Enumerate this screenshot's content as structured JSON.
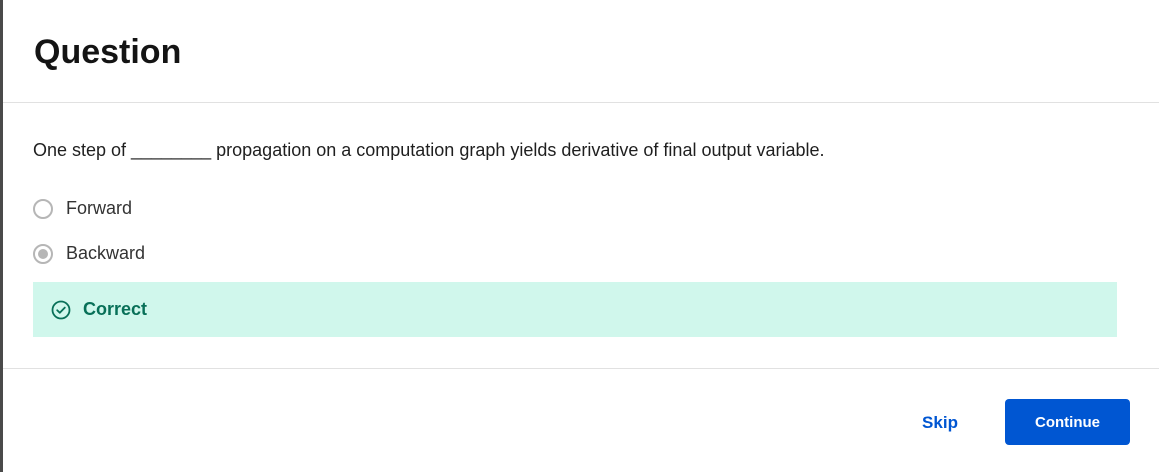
{
  "modal": {
    "title": "Question"
  },
  "question": {
    "text": "One step of ________ propagation on a computation graph yields derivative of final output variable.",
    "options": [
      {
        "label": "Forward",
        "selected": false
      },
      {
        "label": "Backward",
        "selected": true
      }
    ]
  },
  "feedback": {
    "icon": "check-circle-icon",
    "text": "Correct",
    "color": "#087058",
    "background": "#d0f7ec"
  },
  "footer": {
    "skip_label": "Skip",
    "continue_label": "Continue",
    "accent": "#0056d2"
  }
}
